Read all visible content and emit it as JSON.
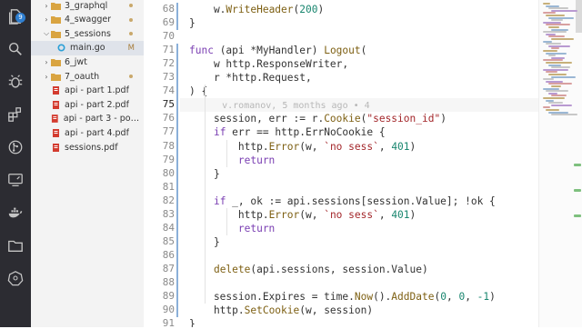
{
  "activity_bar": {
    "items": [
      "files-icon",
      "search-icon",
      "debug-icon",
      "extensions-icon",
      "git-icon",
      "remote-icon",
      "docker-icon",
      "folder-icon",
      "kubernetes-icon"
    ],
    "search_badge": "9"
  },
  "explorer": {
    "items": [
      {
        "label": "3_graphql",
        "kind": "folder",
        "expanded": false,
        "dot": true
      },
      {
        "label": "4_swagger",
        "kind": "folder",
        "expanded": false,
        "dot": true
      },
      {
        "label": "5_sessions",
        "kind": "folder",
        "expanded": true,
        "dot": true
      },
      {
        "label": "main.go",
        "kind": "go-file",
        "badge": "M",
        "selected": true
      },
      {
        "label": "6_jwt",
        "kind": "folder",
        "expanded": false,
        "dot": false
      },
      {
        "label": "7_oauth",
        "kind": "folder",
        "expanded": false,
        "dot": true
      },
      {
        "label": "api - part 1.pdf",
        "kind": "pdf"
      },
      {
        "label": "api - part 2.pdf",
        "kind": "pdf"
      },
      {
        "label": "api - part 3 - post...",
        "kind": "pdf"
      },
      {
        "label": "api - part 4.pdf",
        "kind": "pdf"
      },
      {
        "label": "sessions.pdf",
        "kind": "pdf"
      }
    ]
  },
  "editor": {
    "active_line": 75,
    "blame": "v.romanov, 5 months ago • 4",
    "lines": [
      {
        "n": "68",
        "tokens": [
          [
            "",
            "    w."
          ],
          [
            "fn",
            "WriteHeader"
          ],
          [
            "",
            "("
          ],
          [
            "num",
            "200"
          ],
          [
            "",
            ")"
          ]
        ]
      },
      {
        "n": "69",
        "tokens": [
          [
            "",
            "}"
          ]
        ]
      },
      {
        "n": "70",
        "tokens": []
      },
      {
        "n": "71",
        "tokens": [
          [
            "kw",
            "func"
          ],
          [
            "",
            " (api *MyHandler) "
          ],
          [
            "fn",
            "Logout"
          ],
          [
            "",
            "("
          ]
        ]
      },
      {
        "n": "72",
        "tokens": [
          [
            "",
            "    w http.ResponseWriter,"
          ]
        ]
      },
      {
        "n": "73",
        "tokens": [
          [
            "",
            "    r *http.Request,"
          ]
        ]
      },
      {
        "n": "74",
        "tokens": [
          [
            "",
            ") {"
          ]
        ]
      },
      {
        "n": "75",
        "tokens": []
      },
      {
        "n": "76",
        "tokens": [
          [
            "",
            "    session, err := r."
          ],
          [
            "fn",
            "Cookie"
          ],
          [
            "",
            "("
          ],
          [
            "str",
            "\"session_id\""
          ],
          [
            "",
            ")"
          ]
        ]
      },
      {
        "n": "77",
        "tokens": [
          [
            "",
            "    "
          ],
          [
            "kw",
            "if"
          ],
          [
            "",
            " err == http.ErrNoCookie {"
          ]
        ]
      },
      {
        "n": "78",
        "tokens": [
          [
            "",
            "        http."
          ],
          [
            "fn",
            "Error"
          ],
          [
            "",
            "(w, "
          ],
          [
            "str",
            "`no sess`"
          ],
          [
            "",
            ", "
          ],
          [
            "num",
            "401"
          ],
          [
            "",
            ")"
          ]
        ]
      },
      {
        "n": "79",
        "tokens": [
          [
            "kw",
            "        return"
          ]
        ]
      },
      {
        "n": "80",
        "tokens": [
          [
            "",
            "    }"
          ]
        ]
      },
      {
        "n": "81",
        "tokens": []
      },
      {
        "n": "82",
        "tokens": [
          [
            "",
            "    "
          ],
          [
            "kw",
            "if"
          ],
          [
            "",
            " _, ok := api.sessions[session.Value]; !ok {"
          ]
        ]
      },
      {
        "n": "83",
        "tokens": [
          [
            "",
            "        http."
          ],
          [
            "fn",
            "Error"
          ],
          [
            "",
            "(w, "
          ],
          [
            "str",
            "`no sess`"
          ],
          [
            "",
            ", "
          ],
          [
            "num",
            "401"
          ],
          [
            "",
            ")"
          ]
        ]
      },
      {
        "n": "84",
        "tokens": [
          [
            "kw",
            "        return"
          ]
        ]
      },
      {
        "n": "85",
        "tokens": [
          [
            "",
            "    }"
          ]
        ]
      },
      {
        "n": "86",
        "tokens": []
      },
      {
        "n": "87",
        "tokens": [
          [
            "",
            "    "
          ],
          [
            "fn",
            "delete"
          ],
          [
            "",
            "(api.sessions, session.Value)"
          ]
        ]
      },
      {
        "n": "88",
        "tokens": []
      },
      {
        "n": "89",
        "tokens": [
          [
            "",
            "    session.Expires = time."
          ],
          [
            "fn",
            "Now"
          ],
          [
            "",
            "()."
          ],
          [
            "fn",
            "AddDate"
          ],
          [
            "",
            "("
          ],
          [
            "num",
            "0"
          ],
          [
            "",
            ", "
          ],
          [
            "num",
            "0"
          ],
          [
            "",
            ", "
          ],
          [
            "num",
            "-1"
          ],
          [
            "",
            ")"
          ]
        ]
      },
      {
        "n": "90",
        "tokens": [
          [
            "",
            "    http."
          ],
          [
            "fn",
            "SetCookie"
          ],
          [
            "",
            "(w, session)"
          ]
        ]
      },
      {
        "n": "91",
        "tokens": [
          [
            "",
            "}"
          ]
        ]
      }
    ]
  },
  "colors": {
    "activity_bg": "#2c2c32",
    "sidebar_bg": "#f3f3f3",
    "keyword": "#7a3eb2",
    "function": "#7d5f12",
    "string": "#a3262a",
    "number": "#19866f"
  }
}
